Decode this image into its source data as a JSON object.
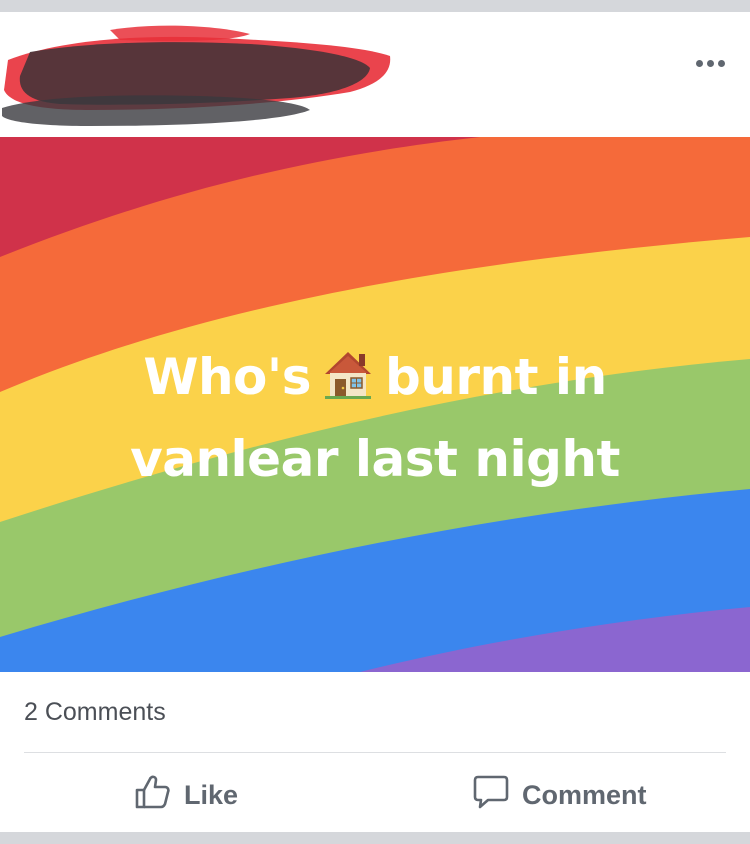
{
  "post": {
    "author_name": "",
    "more_menu_icon": "more-horizontal-icon",
    "caption": {
      "line1_before": "Who's",
      "emoji": "🏠",
      "emoji_icon": "house-emoji-icon",
      "line1_after": "burnt in",
      "line2": "vanlear last night"
    },
    "background_colors": [
      "#d0324a",
      "#f56a3a",
      "#fbd24a",
      "#99c86a",
      "#3b86ee",
      "#8b66d0"
    ]
  },
  "stats": {
    "comments_count": "2 Comments"
  },
  "actions": {
    "like_label": "Like",
    "like_icon": "thumbs-up-icon",
    "comment_label": "Comment",
    "comment_icon": "speech-bubble-icon"
  }
}
